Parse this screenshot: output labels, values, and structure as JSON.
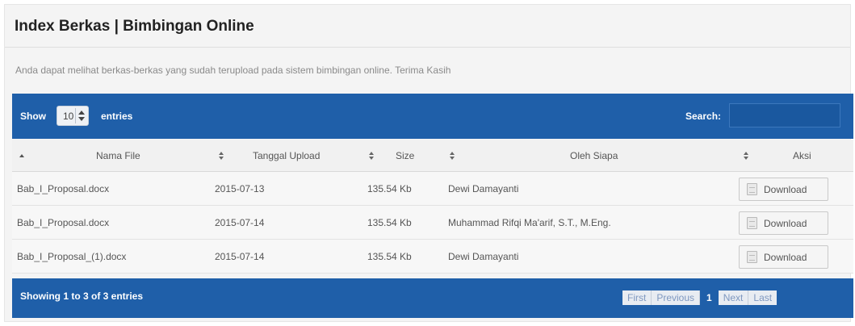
{
  "header": {
    "title": "Index Berkas | Bimbingan Online",
    "description": "Anda dapat melihat berkas-berkas yang sudah terupload pada sistem bimbingan online. Terima Kasih"
  },
  "toolbar": {
    "show_label": "Show",
    "length_value": "10",
    "entries_label": "entries",
    "search_label": "Search:",
    "search_value": ""
  },
  "table": {
    "columns": [
      "Nama File",
      "Tanggal Upload",
      "Size",
      "Oleh Siapa",
      "Aksi"
    ],
    "rows": [
      {
        "file": "Bab_I_Proposal.docx",
        "date": "2015-07-13",
        "size": "135.54 Kb",
        "by": "Dewi Damayanti",
        "action": "Download"
      },
      {
        "file": "Bab_I_Proposal.docx",
        "date": "2015-07-14",
        "size": "135.54 Kb",
        "by": "Muhammad Rifqi Ma'arif, S.T., M.Eng.",
        "action": "Download"
      },
      {
        "file": "Bab_I_Proposal_(1).docx",
        "date": "2015-07-14",
        "size": "135.54 Kb",
        "by": "Dewi Damayanti",
        "action": "Download"
      }
    ]
  },
  "footer": {
    "info": "Showing 1 to 3 of 3 entries",
    "pagination": {
      "first": "First",
      "previous": "Previous",
      "current": "1",
      "next": "Next",
      "last": "Last"
    }
  },
  "colors": {
    "accent": "#1f5fa9"
  },
  "icons": {
    "sort_asc": "sort-asc-icon",
    "sort_both": "sort-both-icon",
    "download": "download-file-icon",
    "spinner": "spinner-arrows-icon"
  }
}
